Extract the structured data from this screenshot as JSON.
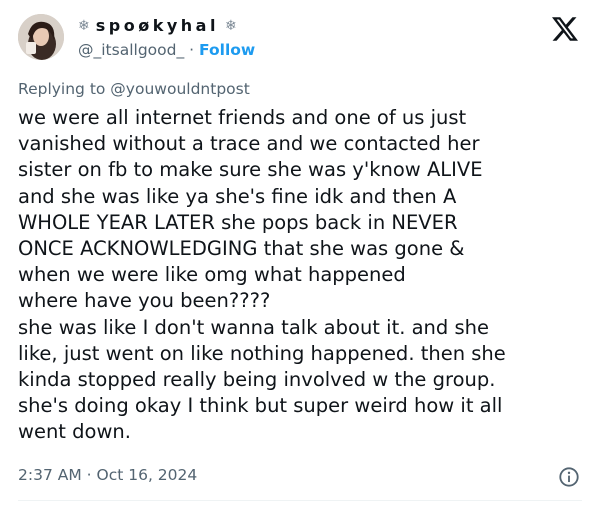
{
  "author": {
    "display_name": "spoøkyhal",
    "decoration_left": "❄",
    "decoration_right": "❄",
    "handle": "@_itsallgood_",
    "separator": "·",
    "follow_label": "Follow",
    "avatar_icon": "profile-photo"
  },
  "reply": {
    "label": "Replying to @youwouldntpost"
  },
  "tweet": {
    "lines": [
      "we were all internet friends and one of us just",
      "vanished without a trace and we contacted her",
      "sister on fb to make sure she was y'know ALIVE",
      "and she was like ya she's fine idk and then A",
      "WHOLE YEAR LATER she pops back in NEVER",
      "ONCE ACKNOWLEDGING that she was gone &",
      "when we were like omg what happened",
      "where have you been????",
      "she was like I don't wanna talk about it. and she",
      "like, just went on like nothing happened. then she",
      "kinda stopped really being involved w the group.",
      "she's doing okay I think but super weird how it all",
      "went down."
    ]
  },
  "meta": {
    "timestamp": "2:37 AM · Oct 16, 2024"
  },
  "colors": {
    "text": "#0f1419",
    "muted": "#536471",
    "accent": "#1d9bf0"
  },
  "icons": {
    "platform": "x-logo-icon",
    "info": "info-icon"
  }
}
